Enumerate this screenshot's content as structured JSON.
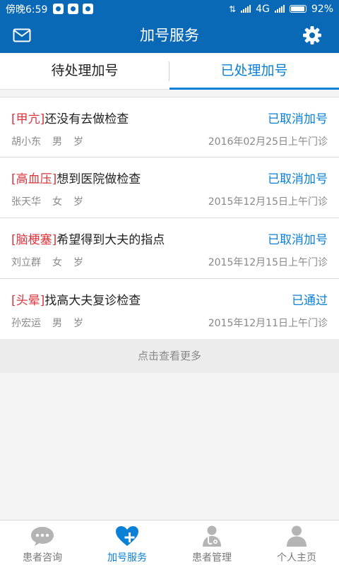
{
  "status_bar": {
    "time": "傍晚6:59",
    "network": "4G",
    "battery": "92%"
  },
  "header": {
    "title": "加号服务"
  },
  "tabs": [
    {
      "label": "待处理加号",
      "active": false
    },
    {
      "label": "已处理加号",
      "active": true
    }
  ],
  "records": [
    {
      "tag": "[甲亢]",
      "subject": "还没有去做检查",
      "status": "已取消加号",
      "name": "胡小东",
      "gender": "男",
      "age_unit": "岁",
      "date": "2016年02月25日上午门诊"
    },
    {
      "tag": "[高血压]",
      "subject": "想到医院做检查",
      "status": "已取消加号",
      "name": "张天华",
      "gender": "女",
      "age_unit": "岁",
      "date": "2015年12月15日上午门诊"
    },
    {
      "tag": "[脑梗塞]",
      "subject": "希望得到大夫的指点",
      "status": "已取消加号",
      "name": "刘立群",
      "gender": "女",
      "age_unit": "岁",
      "date": "2015年12月15日上午门诊"
    },
    {
      "tag": "[头晕]",
      "subject": "找高大夫复诊检查",
      "status": "已通过",
      "name": "孙宏运",
      "gender": "男",
      "age_unit": "岁",
      "date": "2015年12月11日上午门诊"
    }
  ],
  "load_more": "点击查看更多",
  "bottom_nav": [
    {
      "label": "患者咨询",
      "icon": "chat-bubble-icon",
      "active": false
    },
    {
      "label": "加号服务",
      "icon": "heart-plus-icon",
      "active": true
    },
    {
      "label": "患者管理",
      "icon": "doctor-icon",
      "active": false
    },
    {
      "label": "个人主页",
      "icon": "person-icon",
      "active": false
    }
  ],
  "colors": {
    "primary": "#0a69b6",
    "accent": "#0a80d6",
    "tag": "#d9363e"
  }
}
